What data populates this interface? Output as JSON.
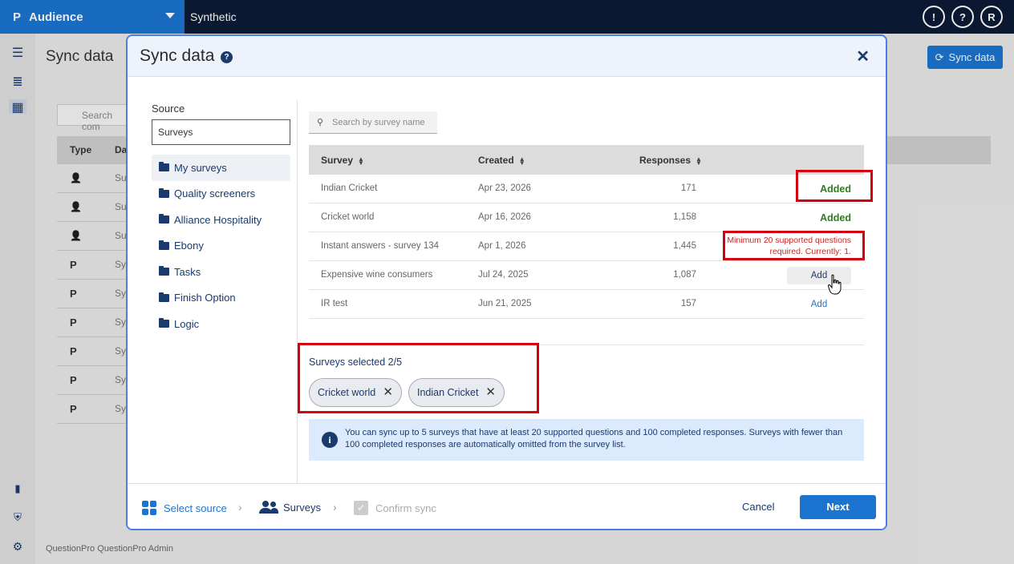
{
  "topbar": {
    "logo": "P",
    "app_name": "Audience",
    "org_name": "Synthetic",
    "icons": [
      {
        "name": "feedback-icon",
        "glyph": "!"
      },
      {
        "name": "help-icon",
        "glyph": "?"
      },
      {
        "name": "user-avatar",
        "glyph": "R"
      }
    ]
  },
  "background_page": {
    "title": "Sync data",
    "sync_button": "Sync data",
    "search_placeholder": "Search com",
    "columns": [
      "Type",
      "Da"
    ],
    "row_prefixes": [
      "Su",
      "Su",
      "Su",
      "Sy",
      "Sy",
      "Sy",
      "Sy",
      "Sy",
      "Sy"
    ],
    "footer": "QuestionPro QuestionPro Admin"
  },
  "modal": {
    "title": "Sync data",
    "source_label": "Source",
    "source_value": "Surveys",
    "folders": [
      "My surveys",
      "Quality screeners",
      "Alliance Hospitality",
      "Ebony",
      "Tasks",
      "Finish Option",
      "Logic"
    ],
    "search_placeholder": "Search by survey name",
    "table": {
      "columns": [
        "Survey",
        "Created",
        "Responses"
      ],
      "rows": [
        {
          "survey": "Indian Cricket",
          "created": "Apr 23, 2026",
          "responses": "171",
          "action": "Added"
        },
        {
          "survey": "Cricket world",
          "created": "Apr 16, 2026",
          "responses": "1,158",
          "action": "Added"
        },
        {
          "survey": "Instant answers - survey 134",
          "created": "Apr 1, 2026",
          "responses": "1,445",
          "warning_line1": "Minimum 20 supported questions",
          "warning_line2": "required. Currently: 1."
        },
        {
          "survey": "Expensive wine consumers",
          "created": "Jul 24, 2025",
          "responses": "1,087",
          "action": "Add"
        },
        {
          "survey": "IR test",
          "created": "Jun 21, 2025",
          "responses": "157",
          "action": "Add"
        }
      ]
    },
    "selected_title": "Surveys selected 2/5",
    "selected_chips": [
      "Cricket world",
      "Indian Cricket"
    ],
    "info_text": "You can sync up to 5 surveys that have at least 20 supported questions and 100 completed responses. Surveys with fewer than 100 completed responses are automatically omitted from the survey list.",
    "steps": [
      "Select source",
      "Surveys",
      "Confirm sync"
    ],
    "cancel_label": "Cancel",
    "next_label": "Next"
  },
  "colors": {
    "topbar": "#0d1b36",
    "accent": "#1b75d0",
    "added_green": "#2e7d1e",
    "warning_red": "#c62828",
    "highlight_box": "#d4000f"
  }
}
